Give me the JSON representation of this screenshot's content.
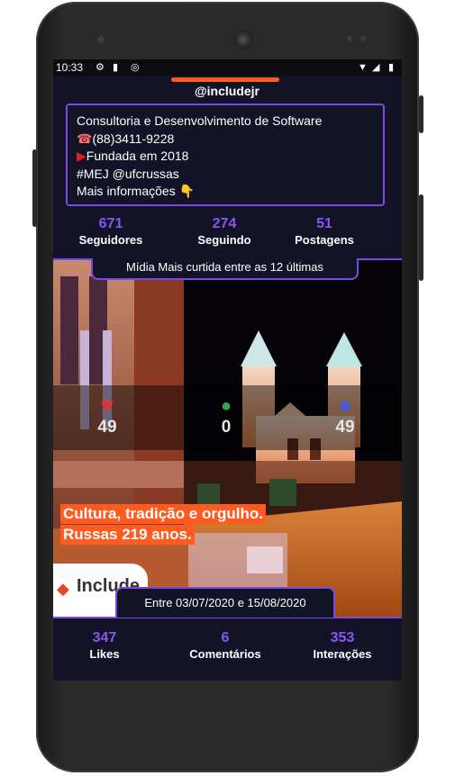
{
  "status_bar": {
    "time": "10:33"
  },
  "profile": {
    "handle": "@includejr",
    "bio": [
      {
        "icon": "",
        "text": "Consultoria e Desenvolvimento de Software"
      },
      {
        "icon": "☎",
        "text": "(88)3411-9228"
      },
      {
        "icon": "▶",
        "text": "Fundada em 2018"
      },
      {
        "icon": "",
        "text": "#MEJ @ufcrussas"
      },
      {
        "icon": "",
        "text": "Mais informações 👇"
      }
    ]
  },
  "profile_stats": [
    {
      "value": "671",
      "label": "Seguidores"
    },
    {
      "value": "274",
      "label": "Seguindo"
    },
    {
      "value": "51",
      "label": "Postagens"
    }
  ],
  "media": {
    "title": "Mídia Mais curtida entre as 12 últimas",
    "likes": "49",
    "comments": "0",
    "interactions": "49",
    "caption_line1": "Cultura, tradição e orgulho.",
    "caption_line2": "Russas 219 anos.",
    "logo_text": "Include",
    "date_range": "Entre 03/07/2020 e 15/08/2020"
  },
  "period_stats": [
    {
      "value": "347",
      "label": "Likes"
    },
    {
      "value": "6",
      "label": "Comentários"
    },
    {
      "value": "353",
      "label": "Interações"
    }
  ],
  "colors": {
    "accent_purple": "#7b48e2",
    "stat_purple": "#8a55f0",
    "orange": "#ff5a1f",
    "background": "#121326"
  }
}
